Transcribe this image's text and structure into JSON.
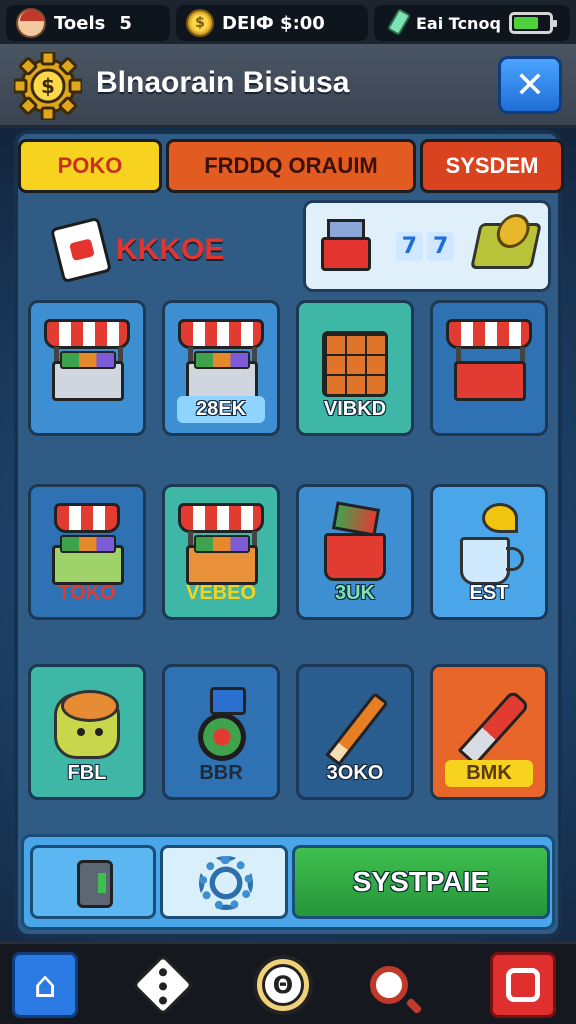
{
  "status": {
    "player_label": "Toels",
    "player_count": "5",
    "coin_label": "DEIФ $:00",
    "coin_icon": "coin-icon",
    "right_label": "Eai Tcnoq",
    "battery_level": 0.7
  },
  "header": {
    "title": "Blnaorain Bisiusa",
    "logo_icon": "gear-coin-icon",
    "close_label": "✕"
  },
  "tabs": [
    {
      "label": "POKO",
      "color": "#f7d21e"
    },
    {
      "label": "FRDDQ ORAUIM",
      "color": "#e25b21"
    },
    {
      "label": "SYSDEM",
      "color": "#d9431f"
    }
  ],
  "promo": {
    "left_label": "KKKOE",
    "right_number": "7",
    "right_number2": "7"
  },
  "tiles": [
    {
      "label": "",
      "icon": "market-stall-icon"
    },
    {
      "label": "28EK",
      "icon": "market-stall-icon"
    },
    {
      "label": "VIBKD",
      "icon": "crate-icon"
    },
    {
      "label": "",
      "icon": "cart-stall-icon"
    },
    {
      "label": "TOKO",
      "icon": "basket-stall-icon"
    },
    {
      "label": "VEBEO",
      "icon": "market-stall-icon"
    },
    {
      "label": "3UK",
      "icon": "bucket-icon"
    },
    {
      "label": "EST",
      "icon": "cup-icon"
    },
    {
      "label": "FBL",
      "icon": "cactus-creature-icon"
    },
    {
      "label": "BBR",
      "icon": "robot-wheel-icon"
    },
    {
      "label": "3OKO",
      "icon": "pencil-icon"
    },
    {
      "label": "BMK",
      "icon": "knife-icon"
    }
  ],
  "bottom_bar": {
    "primary_label": "SYSTPAIE"
  },
  "footer": {
    "home_icon": "home-icon",
    "dice_icon": "dice-icon",
    "center_icon": "coin-ring-icon",
    "center_label": "Θ",
    "lens_icon": "magnifier-icon",
    "stop_icon": "record-icon"
  },
  "colors": {
    "accent_blue": "#2c7be5",
    "accent_green": "#3fbf4f",
    "accent_red": "#e02f2f"
  }
}
